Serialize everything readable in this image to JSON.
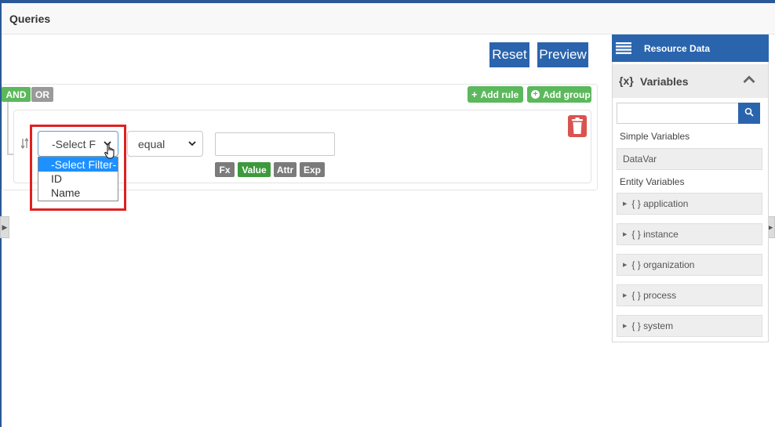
{
  "page": {
    "title": "Queries"
  },
  "toolbar": {
    "reset_label": "Reset",
    "preview_label": "Preview"
  },
  "query_builder": {
    "conditions": [
      "AND",
      "OR"
    ],
    "add_rule_label": "Add rule",
    "add_group_label": "Add group",
    "rule": {
      "filter_value": "-Select F",
      "operator_value": "equal",
      "value_input": "",
      "value_modes": [
        "Fx",
        "Value",
        "Attr",
        "Exp"
      ]
    },
    "filter_dropdown": {
      "options": [
        "-Select Filter-",
        "ID",
        "Name"
      ],
      "selected": "-Select Filter-"
    }
  },
  "resource_panel": {
    "title": "Resource Data",
    "variables_title": "Variables",
    "variables_glyph": "{x}",
    "search_value": "",
    "simple_label": "Simple Variables",
    "simple_items": [
      "DataVar"
    ],
    "entity_label": "Entity Variables",
    "entity_items": [
      "{ } application",
      "{ } instance",
      "{ } organization",
      "{ } process",
      "{ } system"
    ]
  },
  "colors": {
    "accent": "#2a64ad",
    "success": "#5cb85c",
    "danger": "#d9534f",
    "highlight": "#e02020",
    "selection": "#1e90ff"
  },
  "icons": {
    "panel_header": "list-icon",
    "search": "search-icon",
    "delete": "trash-icon",
    "collapse": "chevron-up-icon",
    "cursor": "hand-cursor-icon"
  }
}
